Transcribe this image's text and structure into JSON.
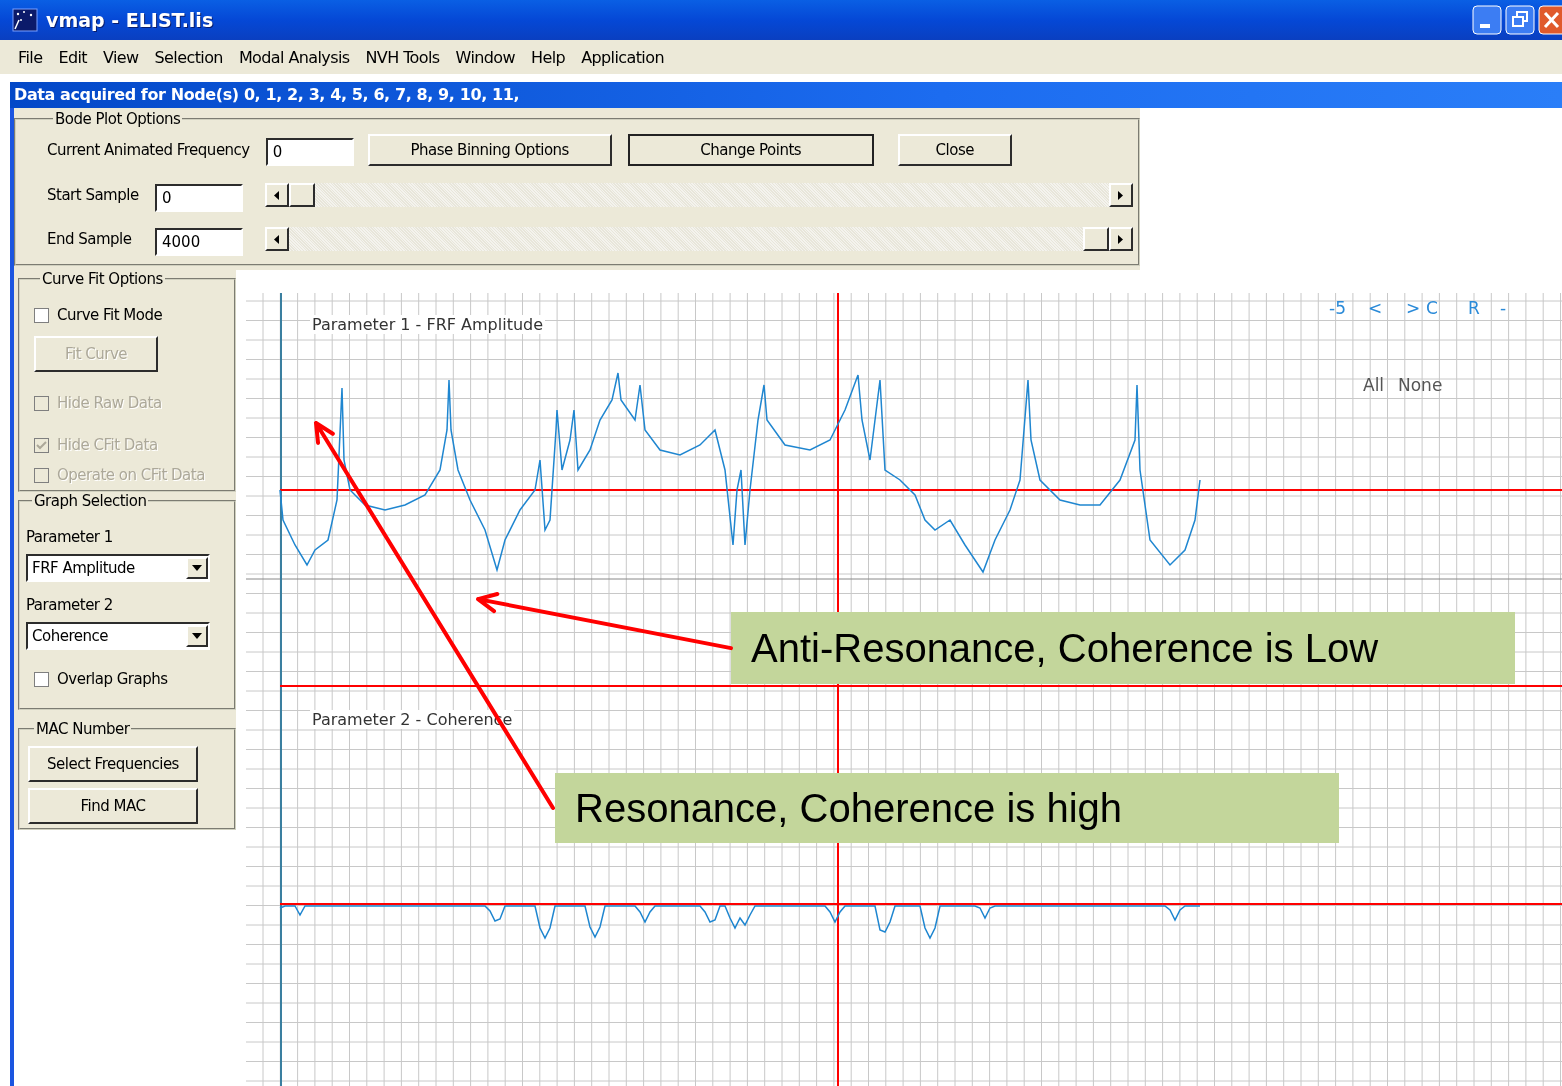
{
  "window": {
    "title": "vmap - ELIST.lis"
  },
  "menu": [
    "File",
    "Edit",
    "View",
    "Selection",
    "Modal Analysis",
    "NVH Tools",
    "Window",
    "Help",
    "Application"
  ],
  "status": "Data acquired for Node(s) 0, 1, 2, 3, 4, 5, 6, 7, 8, 9, 10, 11,",
  "bode_plot_options": {
    "title": "Bode Plot Options",
    "frequency": {
      "label": "Current Animated Frequency",
      "value": "0"
    },
    "buttons": [
      {
        "label": "Phase Binning Options",
        "default": false
      },
      {
        "label": "Change Points",
        "default": true
      },
      {
        "label": "Close",
        "default": false
      }
    ],
    "samples": [
      {
        "label": "Start Sample",
        "value": "0",
        "level": 0
      },
      {
        "label": "End Sample",
        "value": "4000",
        "level": 1
      }
    ]
  },
  "curve_fit_options": {
    "title": "Curve Fit Options",
    "items": [
      {
        "kind": "checkbox",
        "label": "Curve Fit Mode",
        "checked": false,
        "disabled": false
      },
      {
        "kind": "button",
        "label": "Fit Curve",
        "disabled": true
      },
      {
        "kind": "checkbox",
        "label": "Hide Raw Data",
        "checked": false,
        "disabled": true
      },
      {
        "kind": "checkbox",
        "label": "Hide CFit Data",
        "checked": true,
        "disabled": true
      },
      {
        "kind": "checkbox",
        "label": "Operate on CFit Data",
        "checked": false,
        "disabled": true
      }
    ]
  },
  "graph_selection": {
    "title": "Graph Selection",
    "parameters": [
      {
        "label": "Parameter 1",
        "value": "FRF Amplitude"
      },
      {
        "label": "Parameter 2",
        "value": "Coherence"
      }
    ],
    "overlap": {
      "label": "Overlap Graphs",
      "checked": false
    }
  },
  "mac_number": {
    "title": "MAC Number",
    "buttons": [
      "Select Frequencies",
      "Find MAC"
    ]
  },
  "plot": {
    "panels": [
      {
        "title": "Parameter 1 - FRF Amplitude"
      },
      {
        "title": "Parameter 2 - Coherence"
      }
    ],
    "nav": [
      "-5",
      "<",
      ">",
      "C",
      "R",
      "-"
    ],
    "selection": [
      "All",
      "None"
    ]
  },
  "annotations": [
    {
      "text": "Anti-Resonance, Coherence is Low"
    },
    {
      "text": "Resonance, Coherence is high"
    }
  ]
}
